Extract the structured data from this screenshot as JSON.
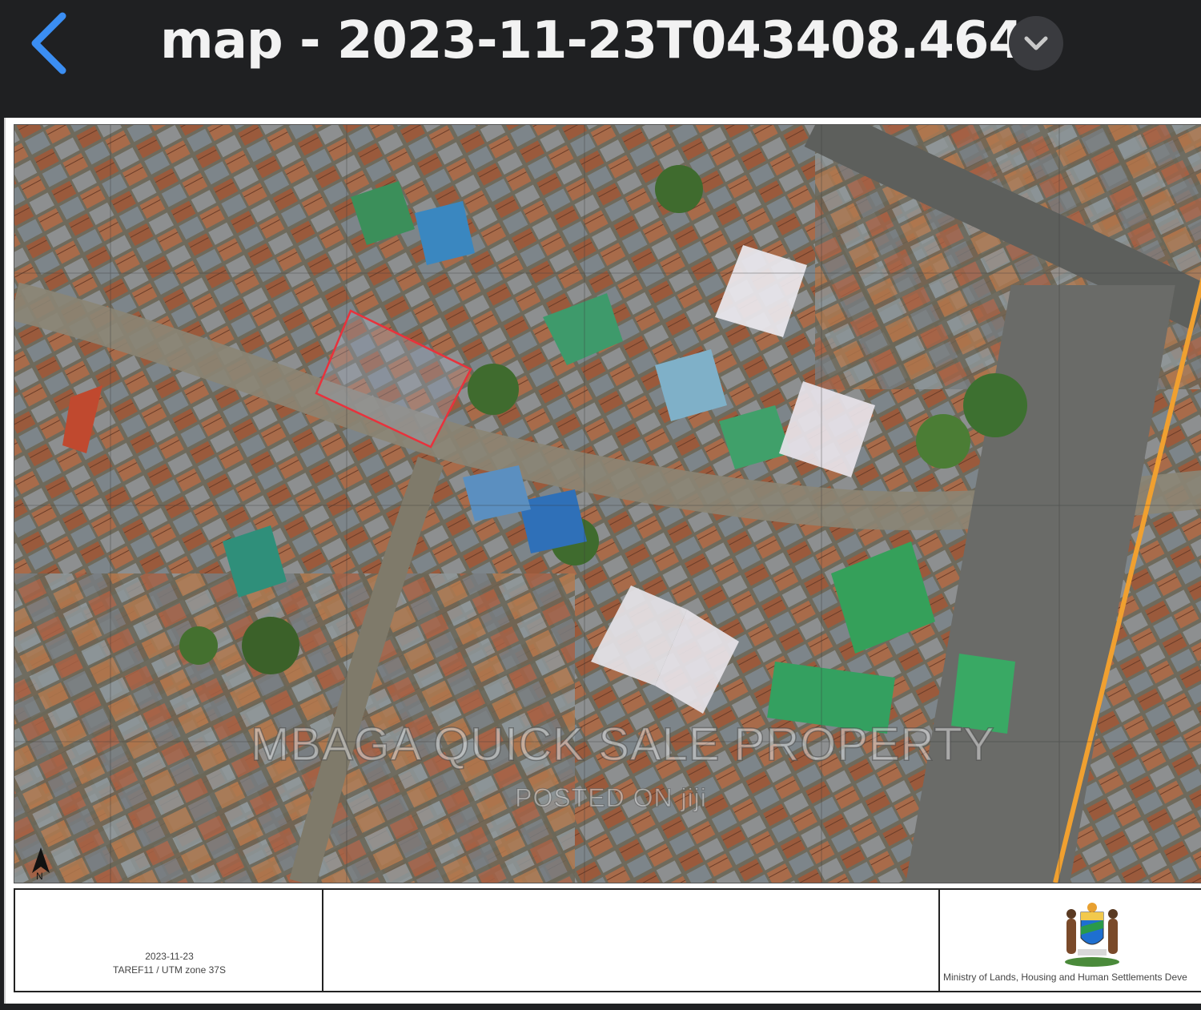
{
  "header": {
    "back_icon": "chevron-left-icon",
    "title": "map - 2023-11-23T043408.464",
    "dropdown_icon": "chevron-down-icon"
  },
  "map": {
    "watermark": "MBAGA QUICK SALE PROPERTY",
    "watermark_sub": "POSTED ON jiji",
    "north_label": "N",
    "highlight_color": "#e8323c",
    "road_color": "#f0a030"
  },
  "title_block": {
    "date": "2023-11-23",
    "crs": "TAREF11 / UTM zone 37S",
    "ministry": "Ministry of Lands, Housing and Human Settlements Deve",
    "emblem_icon": "coat-of-arms-icon"
  }
}
